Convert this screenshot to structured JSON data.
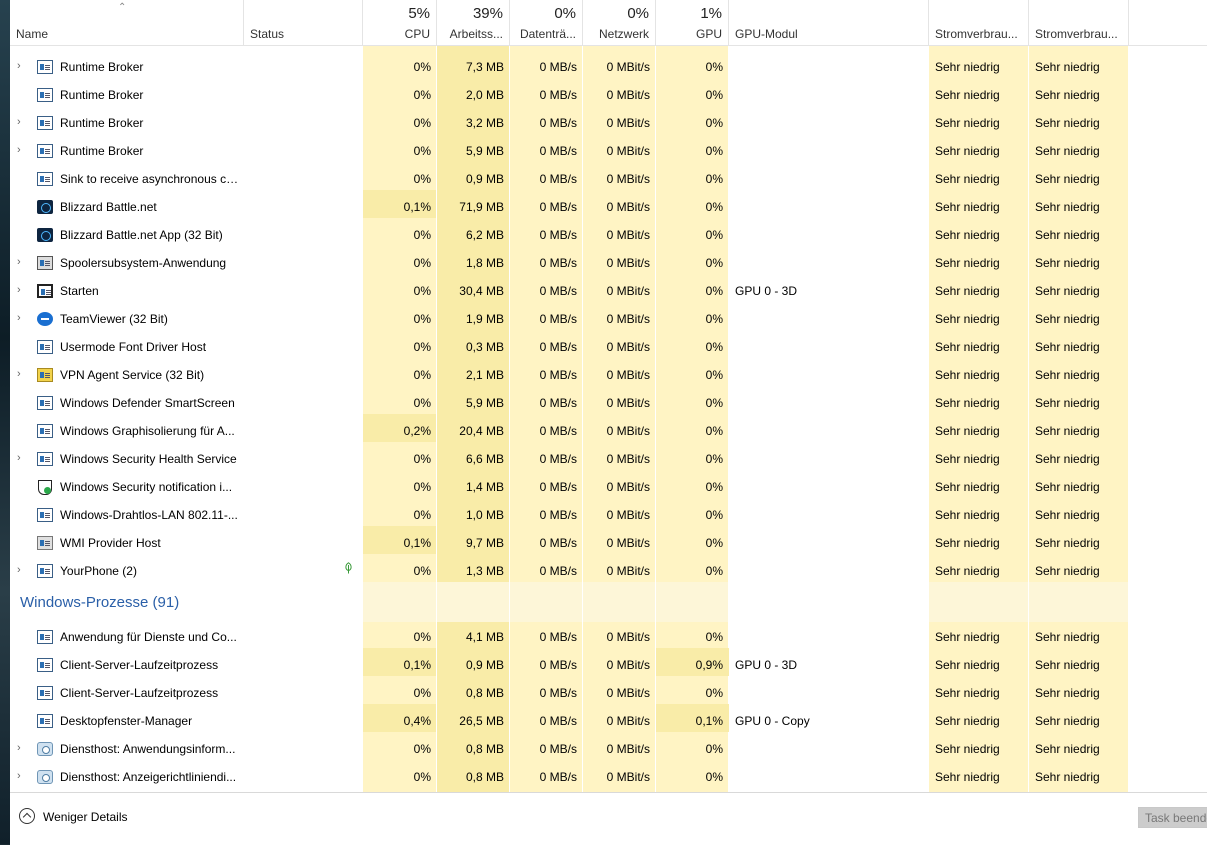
{
  "columns": {
    "name": "Name",
    "status": "Status",
    "cpu": {
      "pct": "5%",
      "label": "CPU"
    },
    "mem": {
      "pct": "39%",
      "label": "Arbeitss..."
    },
    "disk": {
      "pct": "0%",
      "label": "Datenträ..."
    },
    "net": {
      "pct": "0%",
      "label": "Netzwerk"
    },
    "gpu": {
      "pct": "1%",
      "label": "GPU"
    },
    "gpu_engine": "GPU-Modul",
    "power": "Stromverbrau...",
    "power_trend": "Stromverbrau..."
  },
  "rows": [
    {
      "name": "Runtime Broker",
      "icon": "process-icon",
      "expand": true,
      "cpu": "0%",
      "mem": "7,3 MB",
      "disk": "0 MB/s",
      "net": "0 MBit/s",
      "gpu": "0%",
      "engine": "",
      "power": "Sehr niedrig",
      "trend": "Sehr niedrig"
    },
    {
      "name": "Runtime Broker",
      "icon": "process-icon",
      "expand": false,
      "cpu": "0%",
      "mem": "2,0 MB",
      "disk": "0 MB/s",
      "net": "0 MBit/s",
      "gpu": "0%",
      "engine": "",
      "power": "Sehr niedrig",
      "trend": "Sehr niedrig"
    },
    {
      "name": "Runtime Broker",
      "icon": "process-icon",
      "expand": true,
      "cpu": "0%",
      "mem": "3,2 MB",
      "disk": "0 MB/s",
      "net": "0 MBit/s",
      "gpu": "0%",
      "engine": "",
      "power": "Sehr niedrig",
      "trend": "Sehr niedrig"
    },
    {
      "name": "Runtime Broker",
      "icon": "process-icon",
      "expand": true,
      "cpu": "0%",
      "mem": "5,9 MB",
      "disk": "0 MB/s",
      "net": "0 MBit/s",
      "gpu": "0%",
      "engine": "",
      "power": "Sehr niedrig",
      "trend": "Sehr niedrig"
    },
    {
      "name": "Sink to receive asynchronous ca...",
      "icon": "process-icon",
      "expand": false,
      "cpu": "0%",
      "mem": "0,9 MB",
      "disk": "0 MB/s",
      "net": "0 MBit/s",
      "gpu": "0%",
      "engine": "",
      "power": "Sehr niedrig",
      "trend": "Sehr niedrig"
    },
    {
      "name": "Blizzard Battle.net",
      "icon": "battlenet-icon",
      "expand": false,
      "cpu": "0,1%",
      "mem": "71,9 MB",
      "disk": "0 MB/s",
      "net": "0 MBit/s",
      "gpu": "0%",
      "engine": "",
      "power": "Sehr niedrig",
      "trend": "Sehr niedrig"
    },
    {
      "name": "Blizzard Battle.net App (32 Bit)",
      "icon": "battlenet-icon",
      "expand": false,
      "cpu": "0%",
      "mem": "6,2 MB",
      "disk": "0 MB/s",
      "net": "0 MBit/s",
      "gpu": "0%",
      "engine": "",
      "power": "Sehr niedrig",
      "trend": "Sehr niedrig"
    },
    {
      "name": "Spoolersubsystem-Anwendung",
      "icon": "printer-icon",
      "expand": true,
      "cpu": "0%",
      "mem": "1,8 MB",
      "disk": "0 MB/s",
      "net": "0 MBit/s",
      "gpu": "0%",
      "engine": "",
      "power": "Sehr niedrig",
      "trend": "Sehr niedrig"
    },
    {
      "name": "Starten",
      "icon": "start-icon",
      "expand": true,
      "cpu": "0%",
      "mem": "30,4 MB",
      "disk": "0 MB/s",
      "net": "0 MBit/s",
      "gpu": "0%",
      "engine": "GPU 0 - 3D",
      "power": "Sehr niedrig",
      "trend": "Sehr niedrig"
    },
    {
      "name": "TeamViewer (32 Bit)",
      "icon": "teamviewer-icon",
      "expand": true,
      "cpu": "0%",
      "mem": "1,9 MB",
      "disk": "0 MB/s",
      "net": "0 MBit/s",
      "gpu": "0%",
      "engine": "",
      "power": "Sehr niedrig",
      "trend": "Sehr niedrig"
    },
    {
      "name": "Usermode Font Driver Host",
      "icon": "process-icon",
      "expand": false,
      "cpu": "0%",
      "mem": "0,3 MB",
      "disk": "0 MB/s",
      "net": "0 MBit/s",
      "gpu": "0%",
      "engine": "",
      "power": "Sehr niedrig",
      "trend": "Sehr niedrig"
    },
    {
      "name": "VPN Agent Service (32 Bit)",
      "icon": "vpn-icon",
      "expand": true,
      "cpu": "0%",
      "mem": "2,1 MB",
      "disk": "0 MB/s",
      "net": "0 MBit/s",
      "gpu": "0%",
      "engine": "",
      "power": "Sehr niedrig",
      "trend": "Sehr niedrig"
    },
    {
      "name": "Windows Defender SmartScreen",
      "icon": "process-icon",
      "expand": false,
      "cpu": "0%",
      "mem": "5,9 MB",
      "disk": "0 MB/s",
      "net": "0 MBit/s",
      "gpu": "0%",
      "engine": "",
      "power": "Sehr niedrig",
      "trend": "Sehr niedrig"
    },
    {
      "name": "Windows Graphisolierung für A...",
      "icon": "process-icon",
      "expand": false,
      "cpu": "0,2%",
      "mem": "20,4 MB",
      "disk": "0 MB/s",
      "net": "0 MBit/s",
      "gpu": "0%",
      "engine": "",
      "power": "Sehr niedrig",
      "trend": "Sehr niedrig"
    },
    {
      "name": "Windows Security Health Service",
      "icon": "process-icon",
      "expand": true,
      "cpu": "0%",
      "mem": "6,6 MB",
      "disk": "0 MB/s",
      "net": "0 MBit/s",
      "gpu": "0%",
      "engine": "",
      "power": "Sehr niedrig",
      "trend": "Sehr niedrig"
    },
    {
      "name": "Windows Security notification i...",
      "icon": "shield-icon",
      "expand": false,
      "cpu": "0%",
      "mem": "1,4 MB",
      "disk": "0 MB/s",
      "net": "0 MBit/s",
      "gpu": "0%",
      "engine": "",
      "power": "Sehr niedrig",
      "trend": "Sehr niedrig"
    },
    {
      "name": "Windows-Drahtlos-LAN 802.11-...",
      "icon": "process-icon",
      "expand": false,
      "cpu": "0%",
      "mem": "1,0 MB",
      "disk": "0 MB/s",
      "net": "0 MBit/s",
      "gpu": "0%",
      "engine": "",
      "power": "Sehr niedrig",
      "trend": "Sehr niedrig"
    },
    {
      "name": "WMI Provider Host",
      "icon": "wmi-icon",
      "expand": false,
      "cpu": "0,1%",
      "mem": "9,7 MB",
      "disk": "0 MB/s",
      "net": "0 MBit/s",
      "gpu": "0%",
      "engine": "",
      "power": "Sehr niedrig",
      "trend": "Sehr niedrig"
    },
    {
      "name": "YourPhone (2)",
      "icon": "process-icon",
      "expand": true,
      "suspended": true,
      "cpu": "0%",
      "mem": "1,3 MB",
      "disk": "0 MB/s",
      "net": "0 MBit/s",
      "gpu": "0%",
      "engine": "",
      "power": "Sehr niedrig",
      "trend": "Sehr niedrig"
    }
  ],
  "group": {
    "label": "Windows-Prozesse (91)"
  },
  "rows2": [
    {
      "name": "Anwendung für Dienste und Co...",
      "icon": "process-icon",
      "expand": false,
      "cpu": "0%",
      "mem": "4,1 MB",
      "disk": "0 MB/s",
      "net": "0 MBit/s",
      "gpu": "0%",
      "engine": "",
      "power": "Sehr niedrig",
      "trend": "Sehr niedrig"
    },
    {
      "name": "Client-Server-Laufzeitprozess",
      "icon": "process-icon",
      "expand": false,
      "cpu": "0,1%",
      "mem": "0,9 MB",
      "disk": "0 MB/s",
      "net": "0 MBit/s",
      "gpu": "0,9%",
      "engine": "GPU 0 - 3D",
      "power": "Sehr niedrig",
      "trend": "Sehr niedrig"
    },
    {
      "name": "Client-Server-Laufzeitprozess",
      "icon": "process-icon",
      "expand": false,
      "cpu": "0%",
      "mem": "0,8 MB",
      "disk": "0 MB/s",
      "net": "0 MBit/s",
      "gpu": "0%",
      "engine": "",
      "power": "Sehr niedrig",
      "trend": "Sehr niedrig"
    },
    {
      "name": "Desktopfenster-Manager",
      "icon": "process-icon",
      "expand": false,
      "cpu": "0,4%",
      "mem": "26,5 MB",
      "disk": "0 MB/s",
      "net": "0 MBit/s",
      "gpu": "0,1%",
      "engine": "GPU 0 - Copy",
      "power": "Sehr niedrig",
      "trend": "Sehr niedrig"
    },
    {
      "name": "Diensthost: Anwendungsinform...",
      "icon": "gear-icon",
      "expand": true,
      "cpu": "0%",
      "mem": "0,8 MB",
      "disk": "0 MB/s",
      "net": "0 MBit/s",
      "gpu": "0%",
      "engine": "",
      "power": "Sehr niedrig",
      "trend": "Sehr niedrig"
    },
    {
      "name": "Diensthost: Anzeigerichtliniendi...",
      "icon": "gear-icon",
      "expand": true,
      "cpu": "0%",
      "mem": "0,8 MB",
      "disk": "0 MB/s",
      "net": "0 MBit/s",
      "gpu": "0%",
      "engine": "",
      "power": "Sehr niedrig",
      "trend": "Sehr niedrig"
    }
  ],
  "footer": {
    "fewer_details": "Weniger Details",
    "end_task": "Task beenden"
  },
  "colors": {
    "light": "#fff4c4",
    "mid": "#f9eca8",
    "accent": "#2a5fa8"
  }
}
